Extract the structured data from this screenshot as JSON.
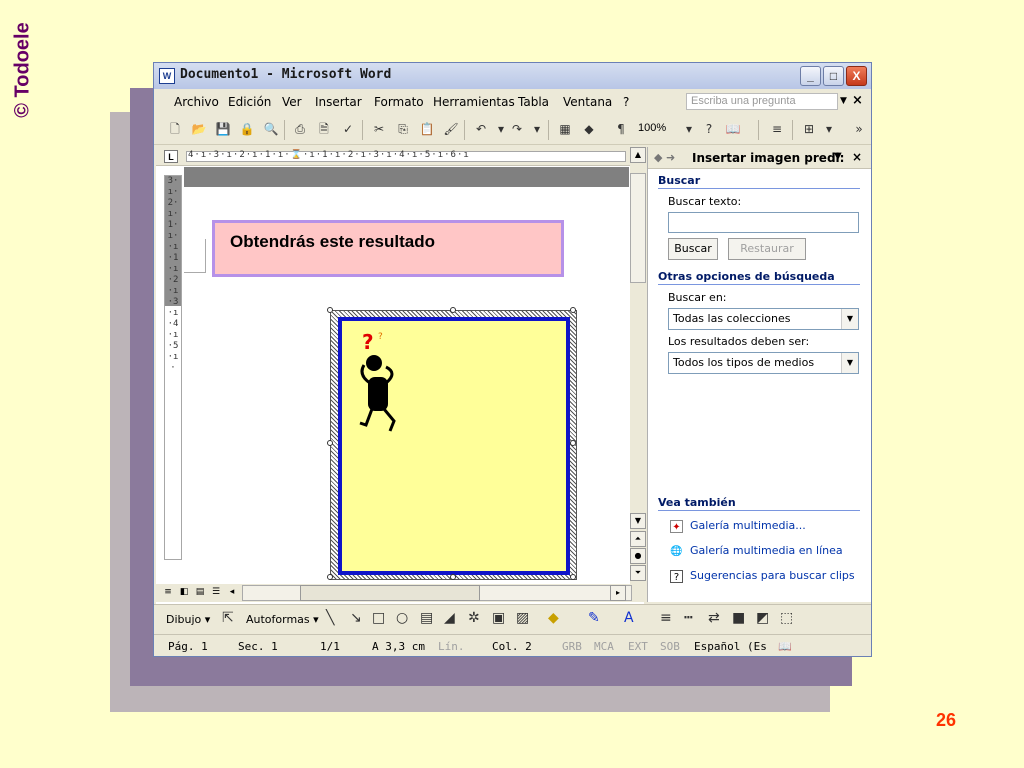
{
  "slide": {
    "watermark": "© Todoele",
    "page_number": "26"
  },
  "window": {
    "title": "Documento1 - Microsoft Word",
    "icon_text": "W",
    "buttons": {
      "minimize": "_",
      "maximize": "□",
      "close": "X"
    }
  },
  "menu": {
    "items": [
      "Archivo",
      "Edición",
      "Ver",
      "Insertar",
      "Formato",
      "Herramientas",
      "Tabla",
      "Ventana",
      "?"
    ],
    "ask_placeholder": "Escriba una pregunta",
    "close": "×"
  },
  "toolbar": {
    "zoom": "100%",
    "icons": [
      "new-doc-icon",
      "open-icon",
      "save-icon",
      "permission-icon",
      "search-doc-icon",
      "print-icon",
      "print-preview-icon",
      "spelling-icon",
      "cut-icon",
      "copy-icon",
      "paste-icon",
      "format-painter-icon",
      "undo-icon",
      "redo-icon",
      "table-icon",
      "drawing-icon",
      "paragraph-mark-icon"
    ]
  },
  "ruler": {
    "horizontal": "4·ı·3·ı·2·ı·1·ı·⌛·ı·1·ı·2·ı·3·ı·4·ı·5·ı·6·ı",
    "vertical": "3·ı·2·ı·1·ı··ı·1·ı·2·ı·3·ı·4·ı·5·ı·"
  },
  "document": {
    "result_text": "Obtendrás este resultado",
    "clipart_symbol": "?"
  },
  "task_pane": {
    "title": "Insertar imagen predi:",
    "search_section": "Buscar",
    "search_text_label": "Buscar texto:",
    "search_text_value": "",
    "search_button": "Buscar",
    "restore_button": "Restaurar",
    "other_options": "Otras opciones de búsqueda",
    "search_in_label": "Buscar en:",
    "search_in_value": "Todas las colecciones",
    "results_label": "Los resultados deben ser:",
    "results_value": "Todos los tipos de medios",
    "see_also": "Vea también",
    "links": [
      "Galería multimedia...",
      "Galería multimedia en línea",
      "Sugerencias para buscar clips"
    ]
  },
  "drawing_toolbar": {
    "draw": "Dibujo ▾",
    "autoshapes": "Autoformas ▾"
  },
  "status": {
    "page": "Pág. 1",
    "section": "Sec. 1",
    "pages": "1/1",
    "at": "A 3,3 cm",
    "line": "Lín.",
    "col": "Col. 2",
    "grb": "GRB",
    "mca": "MCA",
    "ext": "EXT",
    "sob": "SOB",
    "language": "Español (Es"
  },
  "colors": {
    "background": "#ffffcc",
    "result_fill": "#ffc6c6",
    "result_border": "#b691e8",
    "frame_fill": "#ffff99",
    "frame_border": "#0f14c9",
    "page_number": "#ff3300",
    "watermark": "#660066"
  }
}
